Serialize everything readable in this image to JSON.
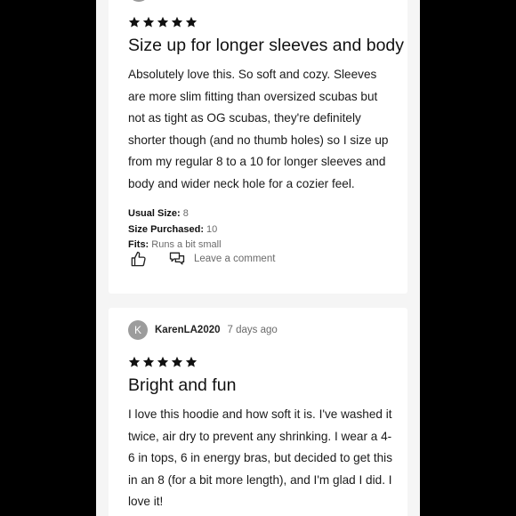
{
  "reviews": [
    {
      "rating": 5,
      "title": "Size up for longer sleeves and body",
      "body": "Absolutely love this. So soft and cozy. Sleeves are more slim fitting than oversized scubas but not as tight as OG scubas, they're definitely shorter though (and no thumb holes) so I size up from my regular 8 to a 10 for longer sleeves and body and wider neck hole for a cozier feel.",
      "fit": {
        "usual_size_label": "Usual Size:",
        "usual_size_value": "8",
        "size_purchased_label": "Size Purchased:",
        "size_purchased_value": "10",
        "fits_label": "Fits:",
        "fits_value": "Runs a bit small"
      },
      "actions": {
        "like_icon": "thumbs-up-icon",
        "comment_icon": "speech-bubbles-icon",
        "comment_label": "Leave a comment"
      }
    },
    {
      "avatar_letter": "K",
      "username": "KarenLA2020",
      "date": "7 days ago",
      "rating": 5,
      "title": "Bright and fun",
      "body": "I love this hoodie and how soft it is. I've washed it twice, air dry to prevent any shrinking. I wear a 4-6 in tops, 6 in energy bras, but decided to get this in an 8 (for a bit more length), and I'm glad I did. I love it!"
    }
  ],
  "colors": {
    "background": "#000000",
    "page": "#f5f5f5",
    "card": "#ffffff",
    "star": "#111111",
    "muted_text": "#6b6b6b",
    "avatar": "#9c9c9c"
  }
}
